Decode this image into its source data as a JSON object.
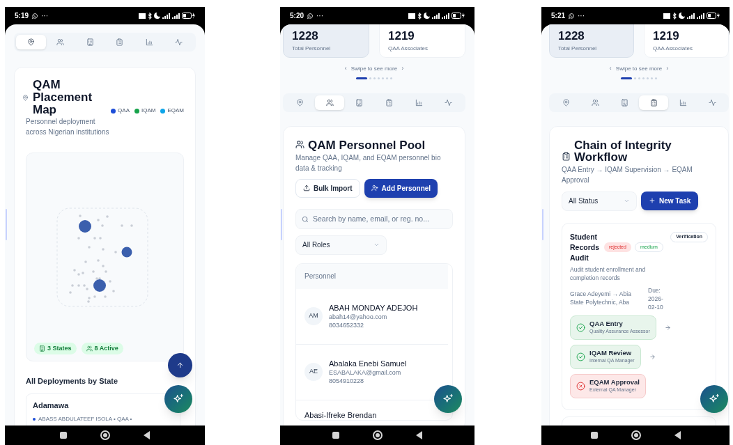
{
  "phones": [
    {
      "kind": "map",
      "status_bar": {
        "time": "5:19",
        "more": "···"
      },
      "tabs": [
        {
          "selected": true
        },
        {
          "selected": false
        },
        {
          "selected": false
        },
        {
          "selected": false
        },
        {
          "selected": false
        },
        {
          "selected": false
        }
      ],
      "title": "QAM Placement Map",
      "subtitle": "Personnel deployment across Nigerian institutions",
      "legend": [
        {
          "label": "QAA",
          "color": "#1d4ed8"
        },
        {
          "label": "IQAM",
          "color": "#16a34a"
        },
        {
          "label": "EQAM",
          "color": "#0ea5e9"
        }
      ],
      "map_badges": [
        {
          "kind": "states",
          "label": "3 States"
        },
        {
          "kind": "active",
          "label": "8 Active"
        }
      ],
      "section_title": "All Deployments by State",
      "deployments": [
        {
          "state": "Adamawa",
          "entries": [
            {
              "text": "ABASS ABDULATEEF ISOLA • QAA •",
              "color": "#1d4ed8"
            }
          ]
        }
      ]
    },
    {
      "kind": "personnel",
      "status_bar": {
        "time": "5:20",
        "more": "···"
      },
      "stats": [
        {
          "value": "1228",
          "label": "Total Personnel",
          "selected": true
        },
        {
          "value": "1219",
          "label": "QAA Associates",
          "selected": false
        }
      ],
      "swipe": {
        "prev": "‹",
        "text": "Swipe to see more",
        "next": "›"
      },
      "pager": [
        {
          "selected": true
        },
        {
          "selected": false
        },
        {
          "selected": false
        },
        {
          "selected": false
        },
        {
          "selected": false
        },
        {
          "selected": false
        },
        {
          "selected": false
        }
      ],
      "tabs": [
        {
          "selected": false
        },
        {
          "selected": true
        },
        {
          "selected": false
        },
        {
          "selected": false
        },
        {
          "selected": false
        },
        {
          "selected": false
        }
      ],
      "title": "QAM Personnel Pool",
      "subtitle": "Manage QAA, IQAM, and EQAM personnel bio data & tracking",
      "actions": [
        {
          "kind": "secondary",
          "label": "Bulk Import"
        },
        {
          "kind": "primary",
          "label": "Add Personnel"
        }
      ],
      "search": {
        "placeholder": "Search by name, email, or reg. no..."
      },
      "filter": {
        "value": "All Roles"
      },
      "table": {
        "columns": [
          "Personnel"
        ],
        "rows": [
          {
            "initials": "AM",
            "name": "ABAH MONDAY ADEJOH",
            "email": "abah14@yahoo.com",
            "phone": "8034652332"
          },
          {
            "initials": "AE",
            "name": "Abalaka Enebi Samuel",
            "email": "ESABALAKA@gmail.com",
            "phone": "8054910228"
          },
          {
            "name": "Abasi-Ifreke Brendan"
          }
        ]
      }
    },
    {
      "kind": "workflow",
      "status_bar": {
        "time": "5:21",
        "more": "···"
      },
      "stats": [
        {
          "value": "1228",
          "label": "Total Personnel",
          "selected": true
        },
        {
          "value": "1219",
          "label": "QAA Associates",
          "selected": false
        }
      ],
      "swipe": {
        "prev": "‹",
        "text": "Swipe to see more",
        "next": "›"
      },
      "pager": [
        {
          "selected": true
        },
        {
          "selected": false
        },
        {
          "selected": false
        },
        {
          "selected": false
        },
        {
          "selected": false
        },
        {
          "selected": false
        },
        {
          "selected": false
        }
      ],
      "tabs": [
        {
          "selected": false
        },
        {
          "selected": false
        },
        {
          "selected": false
        },
        {
          "selected": true
        },
        {
          "selected": false
        },
        {
          "selected": false
        }
      ],
      "title": "Chain of Integrity Workflow",
      "subtitle": "QAA Entry → IQAM Supervision → EQAM Approval",
      "filter": {
        "value": "All Status"
      },
      "actions": [
        {
          "kind": "add",
          "label": "New Task"
        }
      ],
      "tasks": [
        {
          "title": "Student Records Audit",
          "badges": [
            {
              "kind": "status",
              "label": "rejected"
            },
            {
              "kind": "priority",
              "label": "medium"
            }
          ],
          "category": "Verification",
          "description": "Audit student enrollment and completion records",
          "assignment": "Grace Adeyemi → Abia State Polytechnic, Aba",
          "due": "Due: 2026-02-10",
          "steps": [
            {
              "title": "QAA Entry",
              "role": "Quality Assurance Assessor",
              "kind": "done"
            },
            {
              "title": "IQAM Review",
              "role": "Internal QA Manager",
              "kind": "done"
            },
            {
              "title": "EQAM Approval",
              "role": "External QA Manager",
              "kind": "rejected"
            }
          ]
        }
      ]
    }
  ]
}
